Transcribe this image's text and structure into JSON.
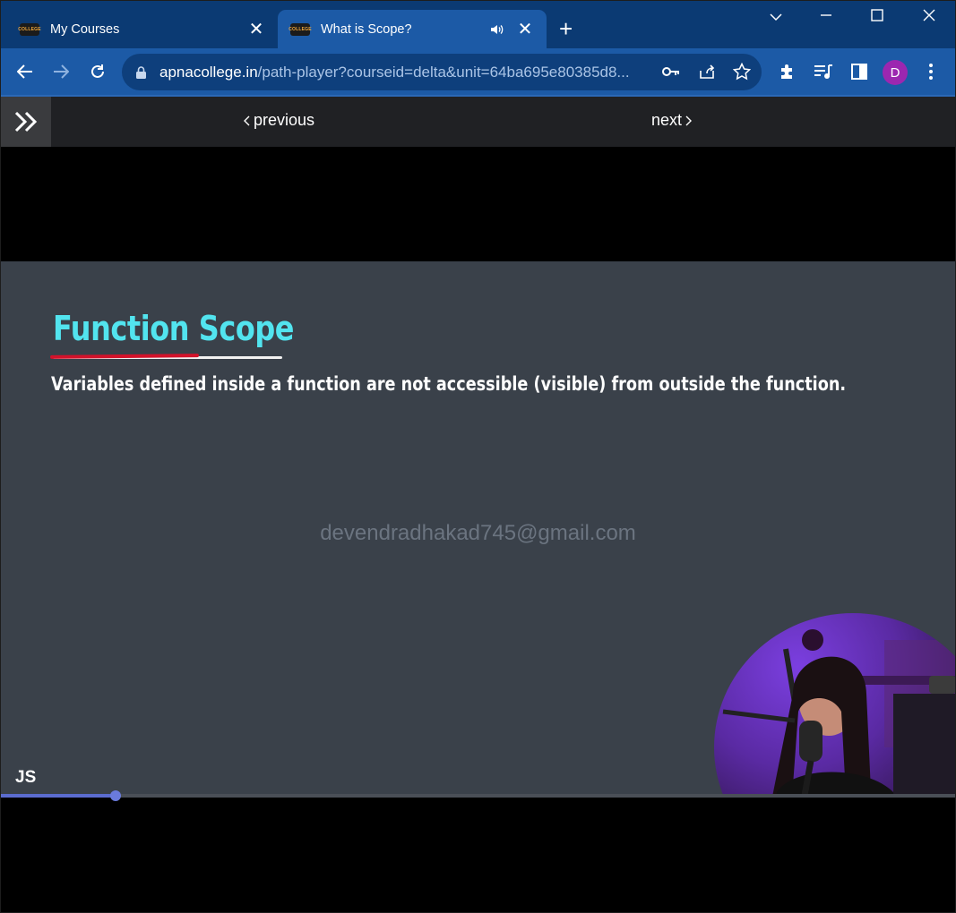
{
  "tabs": [
    {
      "favicon_text": "COLLEGE",
      "title": "My Courses",
      "active": false
    },
    {
      "favicon_text": "COLLEGE",
      "title": "What is Scope?",
      "active": true,
      "audio": true
    }
  ],
  "address_bar": {
    "domain": "apnacollege.in",
    "path": "/path-player?courseid=delta&unit=64ba695e80385d8..."
  },
  "profile": {
    "initial": "D",
    "color": "#9c27b0"
  },
  "player_nav": {
    "previous_label": "previous",
    "next_label": "next"
  },
  "slide": {
    "title": "Function Scope",
    "body": "Variables defined inside a function are not accessible (visible) from outside the function.",
    "watermark": "devendradhakad745@gmail.com",
    "corner_label": "JS"
  },
  "video": {
    "progress": 0.12,
    "progress_color": "#5b6ccf"
  },
  "colors": {
    "tabbar": "#0b3a73",
    "toolbar": "#1c5aa6",
    "slide_bg": "#3a414a",
    "title": "#52e4ef"
  }
}
